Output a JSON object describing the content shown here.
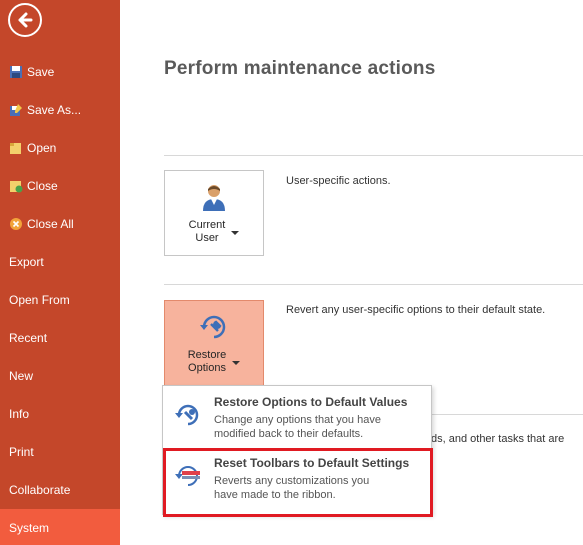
{
  "sidebar": {
    "items": [
      {
        "label": "Save"
      },
      {
        "label": "Save As..."
      },
      {
        "label": "Open"
      },
      {
        "label": "Close"
      },
      {
        "label": "Close All"
      },
      {
        "label": "Export"
      },
      {
        "label": "Open From"
      },
      {
        "label": "Recent"
      },
      {
        "label": "New"
      },
      {
        "label": "Info"
      },
      {
        "label": "Print"
      },
      {
        "label": "Collaborate"
      },
      {
        "label": "System"
      }
    ]
  },
  "main": {
    "title": "Perform maintenance actions",
    "current_user": {
      "label_line1": "Current",
      "label_line2": "User",
      "description": "User-specific actions."
    },
    "restore_options": {
      "label_line1": "Restore",
      "label_line2": "Options",
      "description": "Revert any user-specific options to their default state."
    },
    "partial_text": "ds, and other tasks that are"
  },
  "dropdown": {
    "items": [
      {
        "title": "Restore Options to Default Values",
        "sub_line1": "Change any options that you have",
        "sub_line2": "modified back to their defaults."
      },
      {
        "title": "Reset Toolbars to Default Settings",
        "sub_line1": "Reverts any customizations you",
        "sub_line2": "have made to the ribbon."
      }
    ]
  },
  "colors": {
    "sidebar": "#c4472a",
    "active": "#f25c3e",
    "highlight": "#e01a22"
  }
}
